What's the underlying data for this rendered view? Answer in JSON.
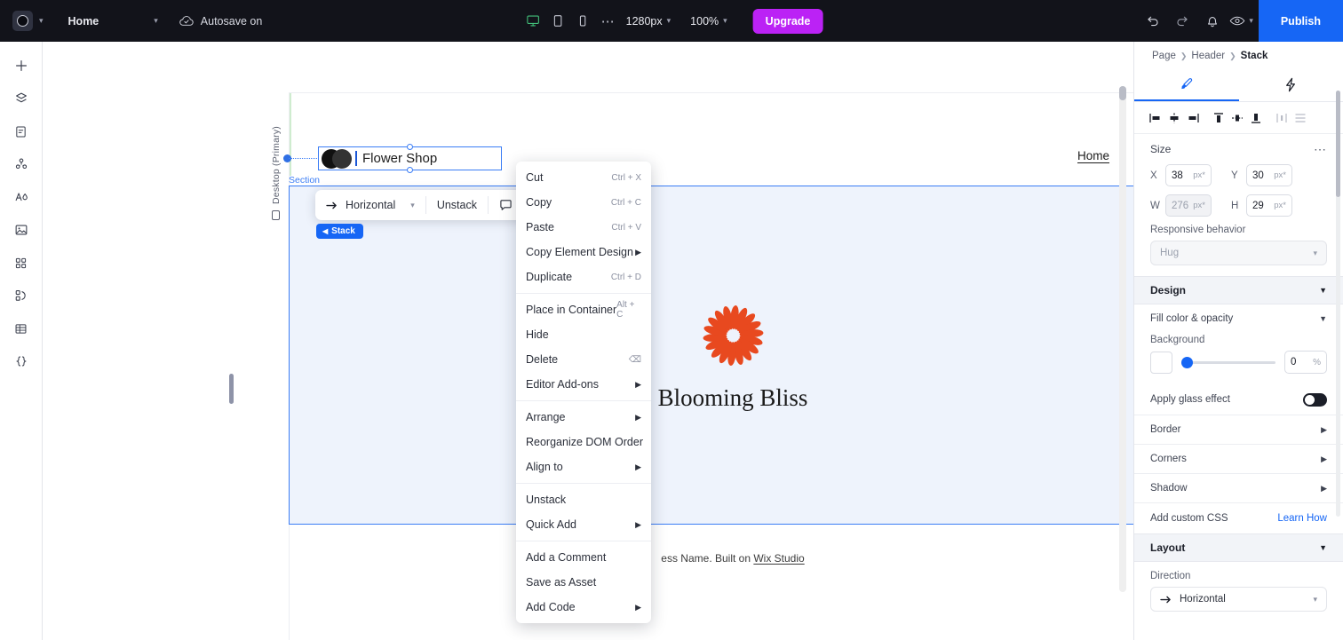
{
  "topbar": {
    "site_menu_label": "Home",
    "autosave_label": "Autosave on",
    "viewports": [
      {
        "name": "desktop-viewport-button",
        "icon": "monitor-icon",
        "active": true
      },
      {
        "name": "tablet-viewport-button",
        "icon": "tablet-icon",
        "active": false
      },
      {
        "name": "mobile-viewport-button",
        "icon": "phone-icon",
        "active": false
      }
    ],
    "more_viewports": "⋯",
    "breakpoint_value": "1280px",
    "zoom_value": "100%",
    "upgrade_label": "Upgrade",
    "publish_label": "Publish",
    "icons": {
      "undo": "undo-icon",
      "redo": "redo-icon",
      "notifications": "bell-icon",
      "preview": "eye-icon"
    }
  },
  "left_rail": {
    "items": [
      {
        "name": "add-elements-button",
        "icon": "plus-icon"
      },
      {
        "name": "layers-button",
        "icon": "layers-icon"
      },
      {
        "name": "pages-button",
        "icon": "page-icon"
      },
      {
        "name": "cms-button",
        "icon": "cms-icon"
      },
      {
        "name": "text-button",
        "icon": "text-icon"
      },
      {
        "name": "media-button",
        "icon": "image-icon"
      },
      {
        "name": "apps-button",
        "icon": "grid-icon"
      },
      {
        "name": "interactions-button",
        "icon": "interactions-icon"
      },
      {
        "name": "tables-button",
        "icon": "table-icon"
      },
      {
        "name": "dev-mode-button",
        "icon": "code-icon"
      }
    ]
  },
  "canvas": {
    "viewport_label": "Desktop (Primary)",
    "section_label": "Section",
    "stack_pill_label": "Stack",
    "selected_text": "Flower Shop",
    "nav_link": "Home",
    "hero_heading": "Blooming Bliss",
    "footer_text": "ess Name. Built on ",
    "footer_link": "Wix Studio",
    "element_toolbar": {
      "direction_label": "Horizontal",
      "unstack_label": "Unstack",
      "comment_icon": "comment-icon",
      "help_icon": "question-mark-icon",
      "more_icon": "more-dots-icon"
    }
  },
  "context_menu": {
    "items": [
      {
        "label": "Cut",
        "shortcut": "Ctrl + X",
        "submenu": false,
        "highlighted": false
      },
      {
        "label": "Copy",
        "shortcut": "Ctrl + C",
        "submenu": false,
        "highlighted": false
      },
      {
        "label": "Paste",
        "shortcut": "Ctrl + V",
        "submenu": false,
        "highlighted": false
      },
      {
        "label": "Copy Element Design",
        "shortcut": "",
        "submenu": true,
        "highlighted": false
      },
      {
        "label": "Duplicate",
        "shortcut": "Ctrl + D",
        "submenu": false,
        "highlighted": false
      },
      {
        "sep": true
      },
      {
        "label": "Place in Container",
        "shortcut": "Alt + C",
        "submenu": false,
        "highlighted": false
      },
      {
        "label": "Hide",
        "shortcut": "",
        "submenu": false,
        "highlighted": false
      },
      {
        "label": "Delete",
        "shortcut": "⌫",
        "submenu": false,
        "highlighted": true
      },
      {
        "label": "Editor Add-ons",
        "shortcut": "",
        "submenu": true,
        "highlighted": false
      },
      {
        "sep": true
      },
      {
        "label": "Arrange",
        "shortcut": "",
        "submenu": true,
        "highlighted": false
      },
      {
        "label": "Reorganize DOM Order",
        "shortcut": "",
        "submenu": false,
        "highlighted": false
      },
      {
        "label": "Align to",
        "shortcut": "",
        "submenu": true,
        "highlighted": false
      },
      {
        "sep": true
      },
      {
        "label": "Unstack",
        "shortcut": "",
        "submenu": false,
        "highlighted": false
      },
      {
        "label": "Quick Add",
        "shortcut": "",
        "submenu": true,
        "highlighted": false
      },
      {
        "sep": true
      },
      {
        "label": "Add a Comment",
        "shortcut": "",
        "submenu": false,
        "highlighted": false
      },
      {
        "label": "Save as Asset",
        "shortcut": "",
        "submenu": false,
        "highlighted": false
      },
      {
        "label": "Add Code",
        "shortcut": "",
        "submenu": true,
        "highlighted": false
      }
    ]
  },
  "right_panel": {
    "breadcrumb": {
      "l1": "Page",
      "l2": "Header",
      "l3": "Stack"
    },
    "tabs": [
      {
        "name": "design-tab",
        "icon": "brush-icon",
        "active": true
      },
      {
        "name": "interactions-tab",
        "icon": "lightning-icon",
        "active": false
      }
    ],
    "size": {
      "title": "Size",
      "x_label": "X",
      "x_value": "38",
      "x_unit": "px*",
      "y_label": "Y",
      "y_value": "30",
      "y_unit": "px*",
      "w_label": "W",
      "w_value": "276",
      "w_unit": "px*",
      "h_label": "H",
      "h_value": "29",
      "h_unit": "px*"
    },
    "responsive": {
      "label": "Responsive behavior",
      "value": "Hug"
    },
    "design": {
      "title": "Design",
      "fill_label": "Fill color & opacity",
      "background_label": "Background",
      "opacity_value": "0",
      "opacity_unit": "%",
      "glass_label": "Apply glass effect",
      "glass_on": false,
      "border_label": "Border",
      "corners_label": "Corners",
      "shadow_label": "Shadow",
      "custom_css_label": "Add custom CSS",
      "learn_how_label": "Learn How"
    },
    "layout": {
      "title": "Layout",
      "direction_label": "Direction",
      "direction_value": "Horizontal"
    }
  },
  "colors": {
    "accent_blue": "#1666f5",
    "upgrade_purple": "#bb22f5",
    "highlight_purple": "#6528c4",
    "flower_orange": "#e8491f",
    "section_blue": "#3b7df5"
  }
}
